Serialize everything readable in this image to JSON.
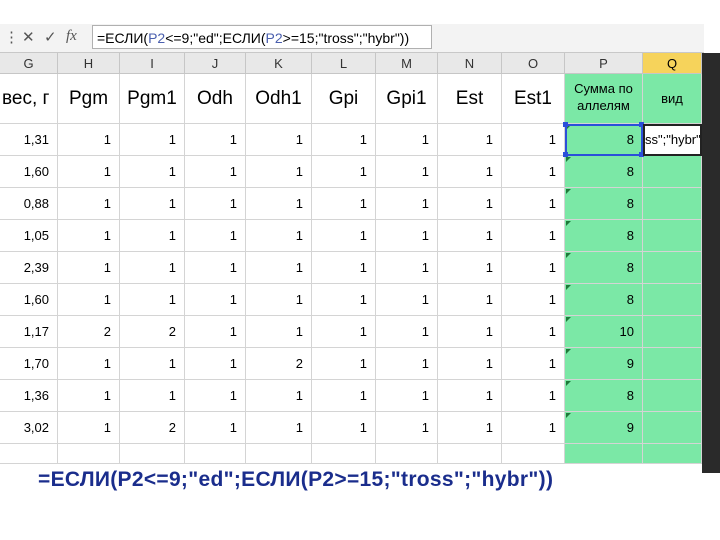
{
  "formula_bar": {
    "cancel_icon": "x-icon",
    "confirm_icon": "check-icon",
    "fx_label": "fx",
    "formula_prefix": "=ЕСЛИ(",
    "formula_ref1": "P2",
    "formula_mid": "<=9;\"ed\";ЕСЛИ(",
    "formula_ref2": "P2",
    "formula_suffix": ">=15;\"tross\";\"hybr\"))"
  },
  "columns": [
    "G",
    "H",
    "I",
    "J",
    "K",
    "L",
    "M",
    "N",
    "O",
    "P",
    "Q"
  ],
  "selected_column": "Q",
  "headers": [
    "вес, г",
    "Pgm",
    "Pgm1",
    "Odh",
    "Odh1",
    "Gpi",
    "Gpi1",
    "Est",
    "Est1",
    "Сумма по аллелям",
    "вид"
  ],
  "editing_cell_text": "ss\";\"hybr\")",
  "rows": [
    [
      "1,31",
      "1",
      "1",
      "1",
      "1",
      "1",
      "1",
      "1",
      "1",
      "8"
    ],
    [
      "1,60",
      "1",
      "1",
      "1",
      "1",
      "1",
      "1",
      "1",
      "1",
      "8"
    ],
    [
      "0,88",
      "1",
      "1",
      "1",
      "1",
      "1",
      "1",
      "1",
      "1",
      "8"
    ],
    [
      "1,05",
      "1",
      "1",
      "1",
      "1",
      "1",
      "1",
      "1",
      "1",
      "8"
    ],
    [
      "2,39",
      "1",
      "1",
      "1",
      "1",
      "1",
      "1",
      "1",
      "1",
      "8"
    ],
    [
      "1,60",
      "1",
      "1",
      "1",
      "1",
      "1",
      "1",
      "1",
      "1",
      "8"
    ],
    [
      "1,17",
      "2",
      "2",
      "1",
      "1",
      "1",
      "1",
      "1",
      "1",
      "10"
    ],
    [
      "1,70",
      "1",
      "1",
      "1",
      "2",
      "1",
      "1",
      "1",
      "1",
      "9"
    ],
    [
      "1,36",
      "1",
      "1",
      "1",
      "1",
      "1",
      "1",
      "1",
      "1",
      "8"
    ],
    [
      "3,02",
      "1",
      "2",
      "1",
      "1",
      "1",
      "1",
      "1",
      "1",
      "9"
    ]
  ],
  "caption": "=ЕСЛИ(P2<=9;\"ed\";ЕСЛИ(P2>=15;\"tross\";\"hybr\"))",
  "colors": {
    "green_fill": "#7be8a6",
    "selected_header": "#f6d35b",
    "caption_color": "#1a2d8c"
  }
}
